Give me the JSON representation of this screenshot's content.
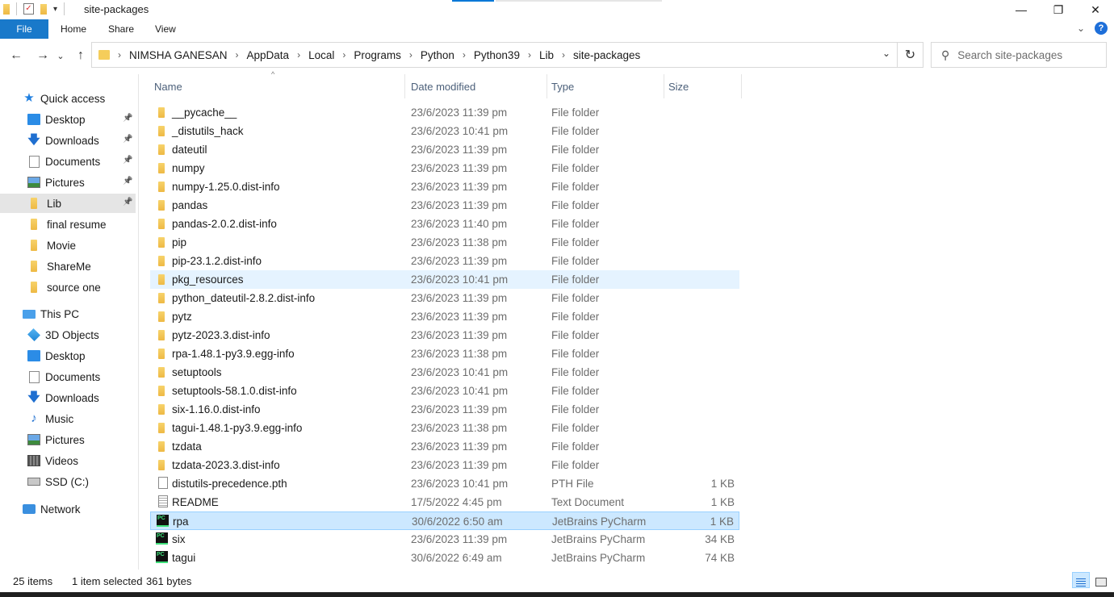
{
  "window": {
    "title": "site-packages",
    "controls": {
      "minimize": "—",
      "maximize": "❐",
      "close": "✕"
    }
  },
  "ribbon": {
    "file": "File",
    "tabs": [
      "Home",
      "Share",
      "View"
    ],
    "help": "?"
  },
  "address": {
    "crumbs": [
      "NIMSHA GANESAN",
      "AppData",
      "Local",
      "Programs",
      "Python",
      "Python39",
      "Lib",
      "site-packages"
    ],
    "search_placeholder": "Search site-packages"
  },
  "sidebar": {
    "quick_access": "Quick access",
    "quick_items": [
      {
        "label": "Desktop",
        "icon": "desktop-icon",
        "pinned": true
      },
      {
        "label": "Downloads",
        "icon": "download-icon",
        "pinned": true
      },
      {
        "label": "Documents",
        "icon": "documents-icon",
        "pinned": true
      },
      {
        "label": "Pictures",
        "icon": "pictures-icon",
        "pinned": true
      },
      {
        "label": "Lib",
        "icon": "folder-icon",
        "pinned": true,
        "selected": true
      },
      {
        "label": "final resume",
        "icon": "folder-icon"
      },
      {
        "label": "Movie",
        "icon": "folder-icon"
      },
      {
        "label": "ShareMe",
        "icon": "folder-icon"
      },
      {
        "label": "source one",
        "icon": "folder-icon"
      }
    ],
    "this_pc": "This PC",
    "pc_items": [
      {
        "label": "3D Objects",
        "icon": "3d-objects-icon"
      },
      {
        "label": "Desktop",
        "icon": "desktop-icon"
      },
      {
        "label": "Documents",
        "icon": "documents-icon"
      },
      {
        "label": "Downloads",
        "icon": "download-icon"
      },
      {
        "label": "Music",
        "icon": "music-icon"
      },
      {
        "label": "Pictures",
        "icon": "pictures-icon"
      },
      {
        "label": "Videos",
        "icon": "videos-icon"
      },
      {
        "label": "SSD (C:)",
        "icon": "drive-icon"
      }
    ],
    "network": "Network"
  },
  "columns": {
    "name": "Name",
    "date": "Date modified",
    "type": "Type",
    "size": "Size"
  },
  "files": [
    {
      "name": "__pycache__",
      "date": "23/6/2023 11:39 pm",
      "type": "File folder",
      "size": "",
      "kind": "folder"
    },
    {
      "name": "_distutils_hack",
      "date": "23/6/2023 10:41 pm",
      "type": "File folder",
      "size": "",
      "kind": "folder"
    },
    {
      "name": "dateutil",
      "date": "23/6/2023 11:39 pm",
      "type": "File folder",
      "size": "",
      "kind": "folder"
    },
    {
      "name": "numpy",
      "date": "23/6/2023 11:39 pm",
      "type": "File folder",
      "size": "",
      "kind": "folder"
    },
    {
      "name": "numpy-1.25.0.dist-info",
      "date": "23/6/2023 11:39 pm",
      "type": "File folder",
      "size": "",
      "kind": "folder"
    },
    {
      "name": "pandas",
      "date": "23/6/2023 11:39 pm",
      "type": "File folder",
      "size": "",
      "kind": "folder"
    },
    {
      "name": "pandas-2.0.2.dist-info",
      "date": "23/6/2023 11:40 pm",
      "type": "File folder",
      "size": "",
      "kind": "folder"
    },
    {
      "name": "pip",
      "date": "23/6/2023 11:38 pm",
      "type": "File folder",
      "size": "",
      "kind": "folder"
    },
    {
      "name": "pip-23.1.2.dist-info",
      "date": "23/6/2023 11:39 pm",
      "type": "File folder",
      "size": "",
      "kind": "folder"
    },
    {
      "name": "pkg_resources",
      "date": "23/6/2023 10:41 pm",
      "type": "File folder",
      "size": "",
      "kind": "folder",
      "state": "hover"
    },
    {
      "name": "python_dateutil-2.8.2.dist-info",
      "date": "23/6/2023 11:39 pm",
      "type": "File folder",
      "size": "",
      "kind": "folder"
    },
    {
      "name": "pytz",
      "date": "23/6/2023 11:39 pm",
      "type": "File folder",
      "size": "",
      "kind": "folder"
    },
    {
      "name": "pytz-2023.3.dist-info",
      "date": "23/6/2023 11:39 pm",
      "type": "File folder",
      "size": "",
      "kind": "folder"
    },
    {
      "name": "rpa-1.48.1-py3.9.egg-info",
      "date": "23/6/2023 11:38 pm",
      "type": "File folder",
      "size": "",
      "kind": "folder"
    },
    {
      "name": "setuptools",
      "date": "23/6/2023 10:41 pm",
      "type": "File folder",
      "size": "",
      "kind": "folder"
    },
    {
      "name": "setuptools-58.1.0.dist-info",
      "date": "23/6/2023 10:41 pm",
      "type": "File folder",
      "size": "",
      "kind": "folder"
    },
    {
      "name": "six-1.16.0.dist-info",
      "date": "23/6/2023 11:39 pm",
      "type": "File folder",
      "size": "",
      "kind": "folder"
    },
    {
      "name": "tagui-1.48.1-py3.9.egg-info",
      "date": "23/6/2023 11:38 pm",
      "type": "File folder",
      "size": "",
      "kind": "folder"
    },
    {
      "name": "tzdata",
      "date": "23/6/2023 11:39 pm",
      "type": "File folder",
      "size": "",
      "kind": "folder"
    },
    {
      "name": "tzdata-2023.3.dist-info",
      "date": "23/6/2023 11:39 pm",
      "type": "File folder",
      "size": "",
      "kind": "folder"
    },
    {
      "name": "distutils-precedence.pth",
      "date": "23/6/2023 10:41 pm",
      "type": "PTH File",
      "size": "1 KB",
      "kind": "file"
    },
    {
      "name": "README",
      "date": "17/5/2022 4:45 pm",
      "type": "Text Document",
      "size": "1 KB",
      "kind": "text"
    },
    {
      "name": "rpa",
      "date": "30/6/2022 6:50 am",
      "type": "JetBrains PyCharm",
      "size": "1 KB",
      "kind": "pycharm",
      "state": "selected"
    },
    {
      "name": "six",
      "date": "23/6/2023 11:39 pm",
      "type": "JetBrains PyCharm",
      "size": "34 KB",
      "kind": "pycharm"
    },
    {
      "name": "tagui",
      "date": "30/6/2022 6:49 am",
      "type": "JetBrains PyCharm",
      "size": "74 KB",
      "kind": "pycharm"
    }
  ],
  "status": {
    "items": "25 items",
    "selected": "1 item selected",
    "size": "361 bytes"
  },
  "pycharm_badge": "PC"
}
